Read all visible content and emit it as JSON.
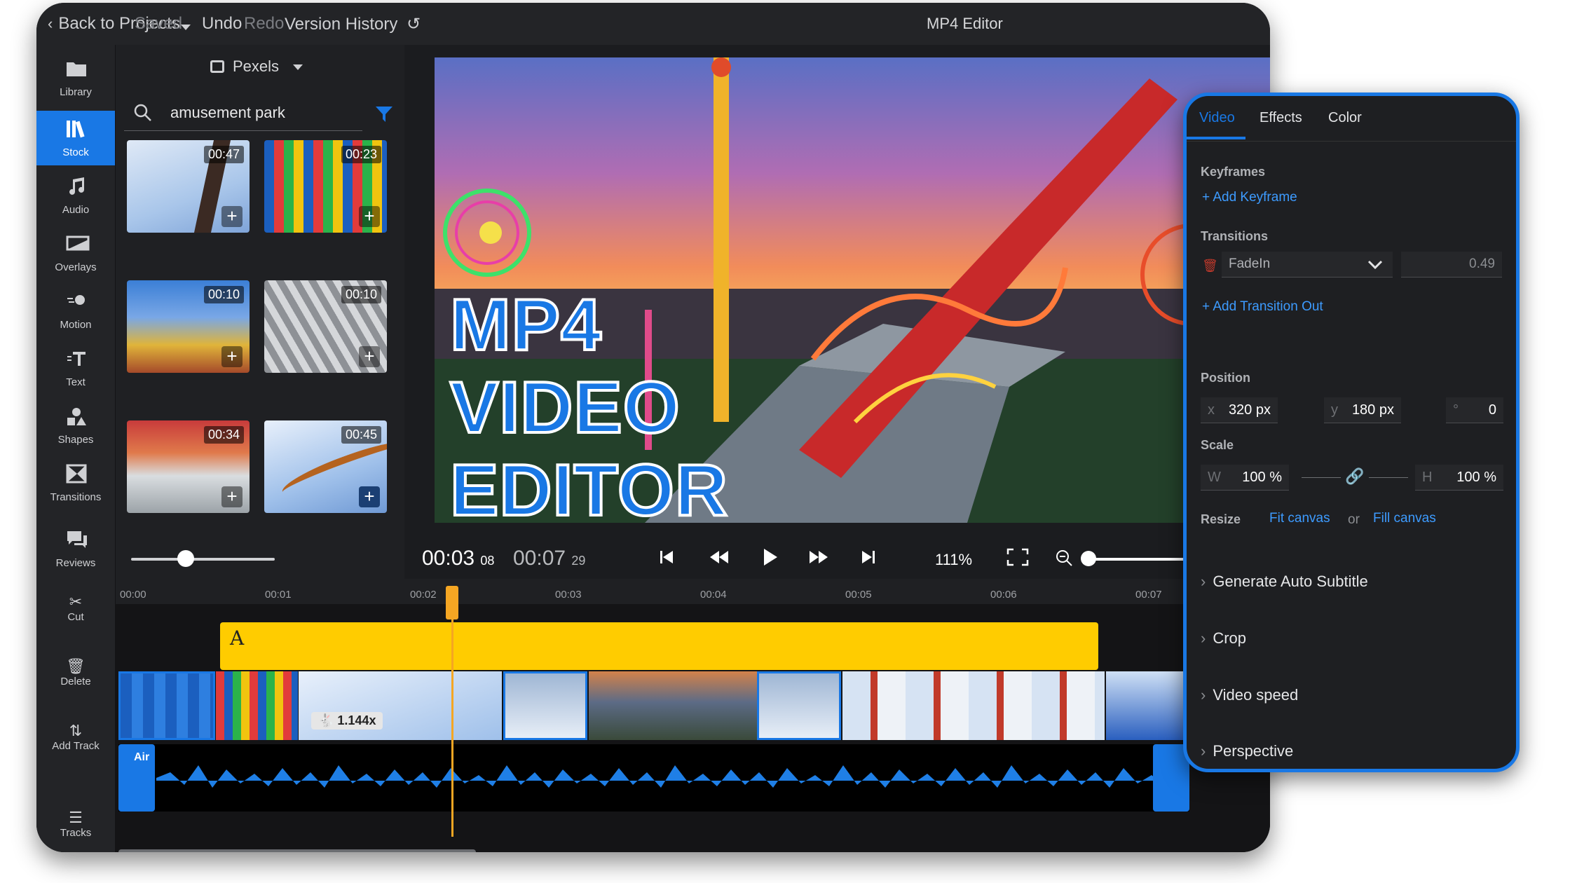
{
  "topbar": {
    "back_label": "Back to Projects",
    "saved_label": "Saved",
    "undo_label": "Undo",
    "redo_label": "Redo",
    "version_history_label": "Version History",
    "title": "MP4 Editor"
  },
  "sidebar": {
    "items": [
      {
        "label": "Library",
        "icon": "folder-icon"
      },
      {
        "label": "Stock",
        "icon": "stock-icon",
        "active": true
      },
      {
        "label": "Audio",
        "icon": "music-note-icon"
      },
      {
        "label": "Overlays",
        "icon": "overlay-icon"
      },
      {
        "label": "Motion",
        "icon": "motion-icon"
      },
      {
        "label": "Text",
        "icon": "text-icon"
      },
      {
        "label": "Shapes",
        "icon": "shapes-icon"
      },
      {
        "label": "Transitions",
        "icon": "transitions-icon"
      },
      {
        "label": "Reviews",
        "icon": "reviews-icon"
      }
    ]
  },
  "stock": {
    "source_label": "Pexels",
    "search_value": "amusement park",
    "thumbnails": [
      {
        "duration": "00:47"
      },
      {
        "duration": "00:23"
      },
      {
        "duration": "00:10"
      },
      {
        "duration": "00:10"
      },
      {
        "duration": "00:34"
      },
      {
        "duration": "00:45"
      }
    ]
  },
  "preview": {
    "overlay_lines": [
      "MP4",
      "VIDEO",
      "EDITOR"
    ]
  },
  "player": {
    "current_time": "00:03",
    "current_frames": "08",
    "total_time": "00:07",
    "total_frames": "29",
    "zoom": "111%"
  },
  "timeline": {
    "ticks": [
      "00:00",
      "00:01",
      "00:02",
      "00:03",
      "00:04",
      "00:05",
      "00:06",
      "00:07"
    ],
    "text_clip_label": "A",
    "speed_badge": "1.144x",
    "audio_clip_label": "Air",
    "tools": [
      {
        "label": "Cut",
        "icon": "scissors-icon"
      },
      {
        "label": "Delete",
        "icon": "trash-icon"
      },
      {
        "label": "Add Track",
        "icon": "add-track-icon"
      },
      {
        "label": "Tracks",
        "icon": "layers-icon"
      }
    ]
  },
  "panel": {
    "tabs": [
      "Video",
      "Effects",
      "Color"
    ],
    "keyframes_heading": "Keyframes",
    "add_keyframe": "Add Keyframe",
    "transitions_heading": "Transitions",
    "transition_name": "FadeIn",
    "transition_value": "0.49",
    "add_transition_out": "Add Transition Out",
    "position_heading": "Position",
    "pos_x_prefix": "x",
    "pos_x": "320 px",
    "pos_y_prefix": "y",
    "pos_y": "180 px",
    "rotation_prefix": "°",
    "rotation": "0",
    "scale_heading": "Scale",
    "scale_w_prefix": "W",
    "scale_w": "100 %",
    "scale_h_prefix": "H",
    "scale_h": "100 %",
    "resize_heading": "Resize",
    "fit_canvas": "Fit canvas",
    "or_label": "or",
    "fill_canvas": "Fill canvas",
    "sections": [
      "Generate Auto Subtitle",
      "Crop",
      "Video speed",
      "Perspective"
    ]
  },
  "colors": {
    "accent": "#1978e5",
    "text_clip": "#ffcc00",
    "playhead": "#f5a623"
  }
}
